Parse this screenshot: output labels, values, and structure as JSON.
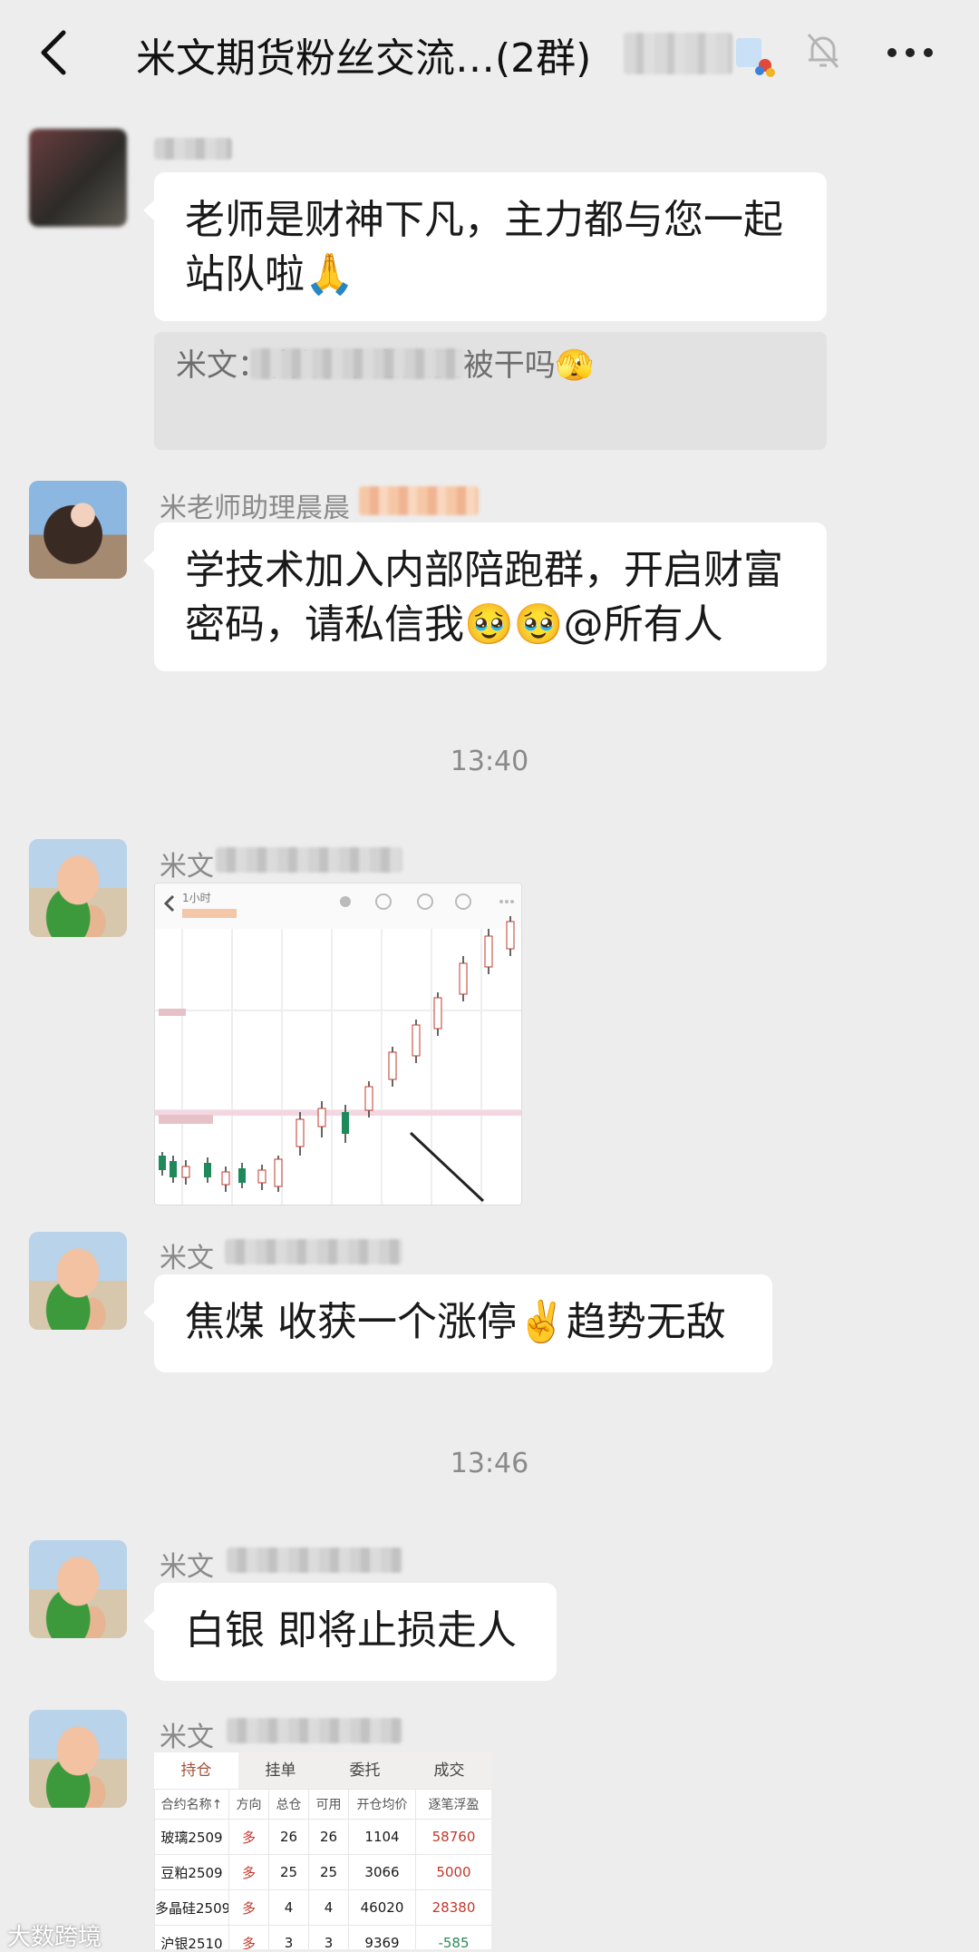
{
  "header": {
    "title": "米文期货粉丝交流…(2群)",
    "back_icon": "chevron-left-icon",
    "mute_icon": "bell-off-icon",
    "more_icon": "ellipsis-icon"
  },
  "messages": [
    {
      "text": "老师是财神下凡，主力都与您一起站队啦🙏",
      "quote": "米文：白银 难道又要被干吗🫣"
    },
    {
      "sender": "米老师助理晨晨",
      "text": "学技术加入内部陪跑群，开启财富密码，请私信我🥹🥹@所有人"
    },
    {
      "time": "13:40"
    },
    {
      "sender": "米文"
    },
    {
      "sender": "米文",
      "text": "焦煤 收获一个涨停✌️趋势无敌"
    },
    {
      "time": "13:46"
    },
    {
      "sender": "米文",
      "text": "白银 即将止损走人"
    },
    {
      "sender": "米文"
    }
  ],
  "chart_image": {
    "label": "1小时"
  },
  "position_table": {
    "tabs": [
      "持仓",
      "挂单",
      "委托",
      "成交"
    ],
    "active_tab": "持仓",
    "columns": [
      "合约名称↑",
      "方向",
      "总仓",
      "可用",
      "开仓均价",
      "逐笔浮盈"
    ],
    "rows": [
      [
        "玻璃2509",
        "多",
        "26",
        "26",
        "1104",
        "58760"
      ],
      [
        "豆粕2509",
        "多",
        "25",
        "25",
        "3066",
        "5000"
      ],
      [
        "多晶硅2509",
        "多",
        "4",
        "4",
        "46020",
        "28380"
      ],
      [
        "沪银2510",
        "多",
        "3",
        "3",
        "9369",
        "-585"
      ]
    ]
  },
  "watermark": "大数跨境"
}
